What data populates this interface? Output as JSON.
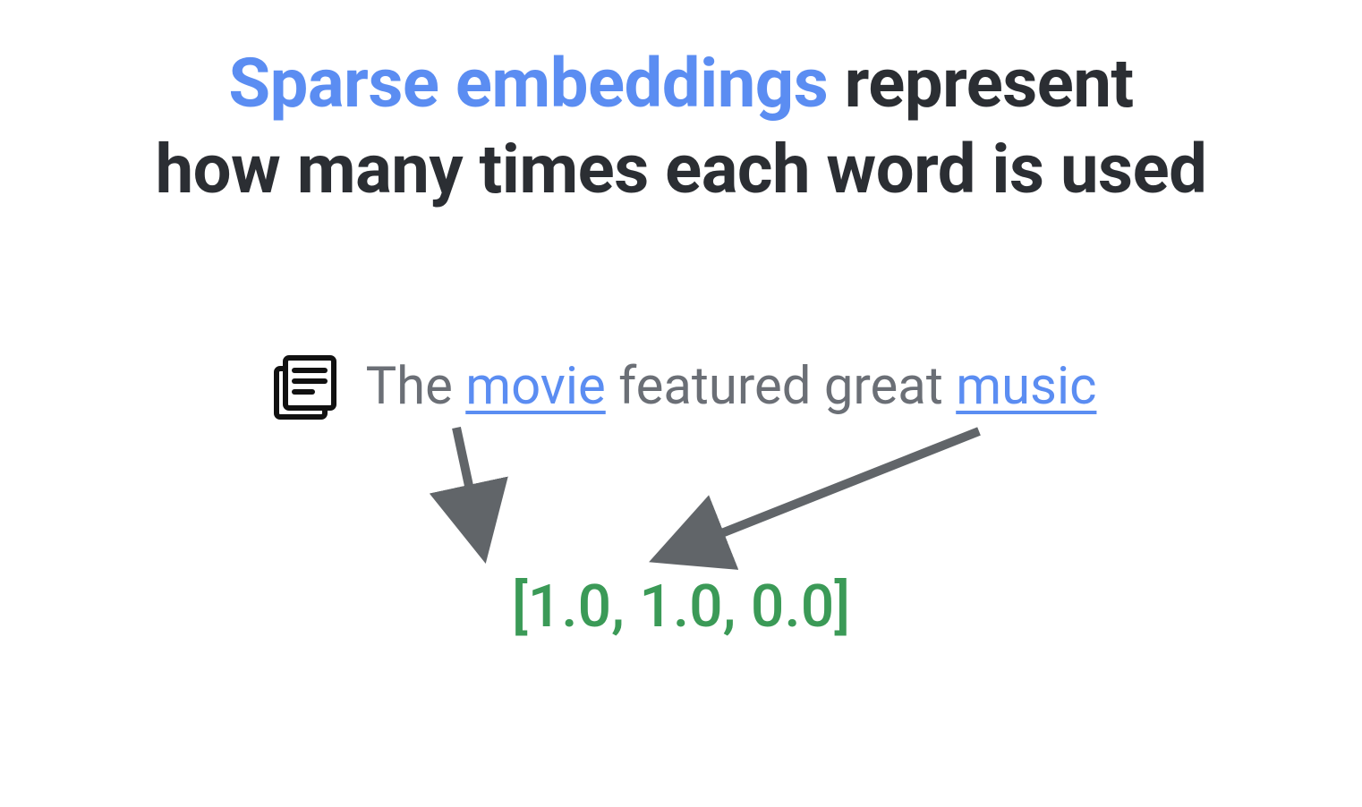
{
  "title": {
    "emphasis": "Sparse embeddings",
    "rest_line1": " represent",
    "line2": "how many times each word is used"
  },
  "sentence": {
    "w1": "The ",
    "hl1": "movie",
    "w2": " featured great ",
    "hl2": "music"
  },
  "vector": {
    "text": "[1.0, 1.0, 0.0]",
    "values": [
      1.0,
      1.0,
      0.0
    ]
  },
  "colors": {
    "accent_blue": "#5b8df2",
    "text_dark": "#2b2e33",
    "text_muted": "#6b6f76",
    "vector_green": "#3b9a57",
    "arrow_gray": "#616569"
  }
}
